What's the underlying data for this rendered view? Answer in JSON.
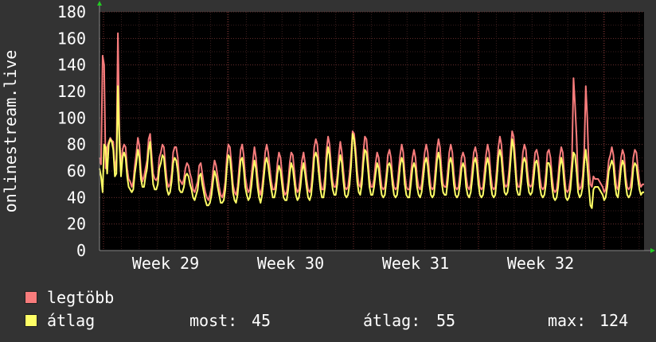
{
  "chart_data": {
    "type": "line",
    "ylabel": "onlinestream.live",
    "ylim": [
      0,
      180
    ],
    "y_ticks": [
      0,
      20,
      40,
      60,
      80,
      100,
      120,
      140,
      160,
      180
    ],
    "x_ticks": [
      "Week 29",
      "Week 30",
      "Week 31",
      "Week 32"
    ],
    "grid": true,
    "legend_position": "bottom-left",
    "series": [
      {
        "name": "legtöbb",
        "color": "#f87c7c",
        "values": [
          70,
          65,
          147,
          140,
          62,
          78,
          82,
          85,
          83,
          82,
          60,
          69,
          164,
          88,
          62,
          76,
          80,
          78,
          62,
          54,
          52,
          48,
          52,
          64,
          73,
          85,
          79,
          60,
          52,
          56,
          62,
          68,
          84,
          88,
          72,
          58,
          54,
          53,
          56,
          70,
          74,
          80,
          78,
          64,
          52,
          48,
          50,
          58,
          74,
          78,
          78,
          70,
          54,
          52,
          50,
          54,
          62,
          66,
          64,
          58,
          54,
          46,
          44,
          48,
          52,
          64,
          66,
          58,
          50,
          44,
          40,
          38,
          42,
          48,
          60,
          68,
          64,
          56,
          48,
          42,
          40,
          44,
          52,
          70,
          80,
          78,
          66,
          50,
          44,
          42,
          48,
          62,
          76,
          80,
          72,
          56,
          48,
          44,
          46,
          56,
          68,
          78,
          70,
          56,
          46,
          42,
          48,
          60,
          74,
          80,
          74,
          62,
          52,
          46,
          46,
          52,
          66,
          74,
          70,
          58,
          46,
          42,
          44,
          52,
          66,
          74,
          72,
          60,
          48,
          44,
          46,
          56,
          68,
          74,
          66,
          54,
          46,
          44,
          48,
          62,
          78,
          84,
          80,
          66,
          52,
          46,
          46,
          56,
          76,
          86,
          80,
          64,
          52,
          48,
          48,
          56,
          72,
          82,
          74,
          60,
          48,
          46,
          48,
          58,
          72,
          90,
          88,
          76,
          60,
          50,
          48,
          56,
          74,
          86,
          84,
          70,
          54,
          48,
          48,
          54,
          66,
          74,
          70,
          58,
          48,
          46,
          48,
          58,
          72,
          76,
          70,
          56,
          48,
          46,
          48,
          60,
          72,
          80,
          74,
          58,
          48,
          46,
          46,
          58,
          70,
          76,
          70,
          56,
          48,
          46,
          50,
          62,
          74,
          80,
          74,
          58,
          48,
          46,
          48,
          62,
          76,
          84,
          78,
          60,
          50,
          48,
          48,
          60,
          74,
          80,
          74,
          58,
          48,
          46,
          48,
          58,
          70,
          74,
          70,
          56,
          48,
          46,
          50,
          62,
          74,
          78,
          72,
          58,
          48,
          46,
          48,
          60,
          72,
          80,
          74,
          58,
          48,
          46,
          48,
          62,
          78,
          86,
          80,
          64,
          50,
          48,
          50,
          60,
          76,
          90,
          86,
          70,
          52,
          48,
          48,
          60,
          74,
          80,
          76,
          60,
          50,
          48,
          50,
          62,
          74,
          76,
          70,
          56,
          48,
          46,
          48,
          58,
          74,
          76,
          70,
          56,
          46,
          44,
          46,
          56,
          70,
          78,
          74,
          58,
          46,
          44,
          46,
          54,
          68,
          130,
          110,
          86,
          52,
          46,
          48,
          56,
          76,
          124,
          100,
          62,
          50,
          48,
          56,
          54,
          54,
          54,
          52,
          50,
          48,
          44,
          46,
          56,
          68,
          72,
          78,
          72,
          58,
          48,
          46,
          58,
          70,
          76,
          72,
          56,
          48,
          46,
          48,
          56,
          70,
          76,
          74,
          62,
          52,
          48,
          50,
          50
        ]
      },
      {
        "name": "átlag",
        "color": "#ffff66",
        "values": [
          62,
          56,
          44,
          80,
          78,
          58,
          80,
          84,
          82,
          76,
          56,
          58,
          124,
          80,
          56,
          70,
          74,
          70,
          56,
          48,
          46,
          44,
          46,
          58,
          66,
          76,
          70,
          54,
          48,
          48,
          56,
          62,
          76,
          82,
          64,
          50,
          46,
          46,
          50,
          62,
          66,
          72,
          70,
          56,
          46,
          42,
          44,
          52,
          66,
          70,
          68,
          60,
          46,
          44,
          44,
          48,
          56,
          58,
          56,
          50,
          46,
          40,
          38,
          42,
          46,
          56,
          58,
          50,
          44,
          38,
          34,
          34,
          36,
          42,
          52,
          60,
          56,
          48,
          42,
          36,
          36,
          38,
          46,
          62,
          72,
          70,
          58,
          44,
          38,
          36,
          42,
          54,
          68,
          70,
          62,
          48,
          42,
          38,
          40,
          48,
          60,
          68,
          62,
          48,
          40,
          36,
          42,
          54,
          66,
          70,
          64,
          54,
          46,
          40,
          40,
          46,
          58,
          64,
          60,
          50,
          40,
          38,
          38,
          46,
          58,
          66,
          62,
          52,
          42,
          38,
          40,
          48,
          60,
          66,
          58,
          48,
          40,
          38,
          42,
          54,
          70,
          74,
          70,
          58,
          46,
          40,
          40,
          48,
          68,
          78,
          72,
          56,
          46,
          42,
          42,
          50,
          64,
          72,
          66,
          52,
          42,
          40,
          42,
          50,
          64,
          88,
          84,
          70,
          52,
          44,
          42,
          50,
          66,
          76,
          74,
          62,
          48,
          42,
          42,
          48,
          58,
          66,
          62,
          50,
          42,
          40,
          42,
          52,
          64,
          66,
          62,
          50,
          42,
          40,
          42,
          52,
          64,
          70,
          66,
          50,
          42,
          40,
          40,
          50,
          62,
          66,
          62,
          48,
          42,
          40,
          44,
          54,
          66,
          70,
          64,
          50,
          42,
          40,
          42,
          54,
          68,
          74,
          68,
          52,
          44,
          42,
          42,
          52,
          66,
          70,
          64,
          50,
          42,
          40,
          42,
          50,
          62,
          66,
          62,
          48,
          42,
          40,
          44,
          54,
          66,
          70,
          64,
          50,
          42,
          40,
          42,
          52,
          64,
          70,
          64,
          50,
          42,
          40,
          42,
          54,
          70,
          76,
          70,
          56,
          44,
          42,
          44,
          52,
          68,
          84,
          78,
          62,
          46,
          42,
          42,
          52,
          66,
          70,
          66,
          52,
          44,
          42,
          44,
          54,
          66,
          68,
          62,
          48,
          42,
          40,
          42,
          50,
          66,
          66,
          62,
          48,
          40,
          38,
          40,
          48,
          62,
          70,
          64,
          50,
          40,
          38,
          40,
          46,
          60,
          74,
          72,
          60,
          44,
          40,
          42,
          48,
          66,
          76,
          64,
          48,
          34,
          32,
          46,
          48,
          48,
          48,
          46,
          44,
          42,
          38,
          40,
          48,
          60,
          64,
          68,
          64,
          50,
          42,
          40,
          50,
          62,
          68,
          64,
          50,
          42,
          40,
          42,
          48,
          62,
          66,
          64,
          54,
          46,
          42,
          44,
          44
        ]
      }
    ]
  },
  "legend": {
    "items": [
      {
        "label": "legtöbb",
        "color": "#f87c7c"
      },
      {
        "label": "átlag",
        "color": "#ffff66"
      }
    ],
    "stats": {
      "most_label": "most:",
      "most_value": "45",
      "atlag_label": "átlag:",
      "atlag_value": "55",
      "max_label": "max:",
      "max_value": "124"
    }
  }
}
